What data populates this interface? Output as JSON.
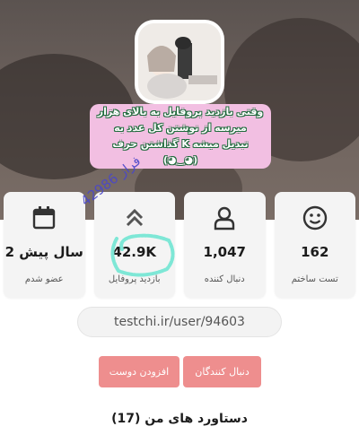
{
  "profile": {
    "bio": "وقتی بازدید پروفایل به بالای هزار میرسه از نوشتن کل عدد به گذاشتن حرف K تبدیل میشه (◕‿◕)"
  },
  "stats": [
    {
      "id": "tests",
      "value": "162",
      "label": "تست ساختم",
      "icon": "smiley-icon"
    },
    {
      "id": "followers",
      "value": "1,047",
      "label": "دنبال کننده",
      "icon": "user-icon"
    },
    {
      "id": "views",
      "value": "42.9K",
      "label": "بازدید پروفایل",
      "icon": "double-chevron-up-icon"
    },
    {
      "id": "membership",
      "value": "2 سال پیش",
      "label": "عضو شدم",
      "icon": "calendar-icon"
    }
  ],
  "watermark": {
    "text": "فراز 42986"
  },
  "profile_url": "testchi.ir/user/94603",
  "buttons": {
    "followers": "دنبال کنندگان",
    "add_friend": "افزودن دوست"
  },
  "achievements": {
    "title": "دستاورد های من (17)"
  },
  "colors": {
    "button": "#ee8e8e",
    "card": "#f4f4f4",
    "bio_bg": "#f2bfe2",
    "scribble": "#7ee7d6",
    "watermark": "#4a47c9"
  }
}
